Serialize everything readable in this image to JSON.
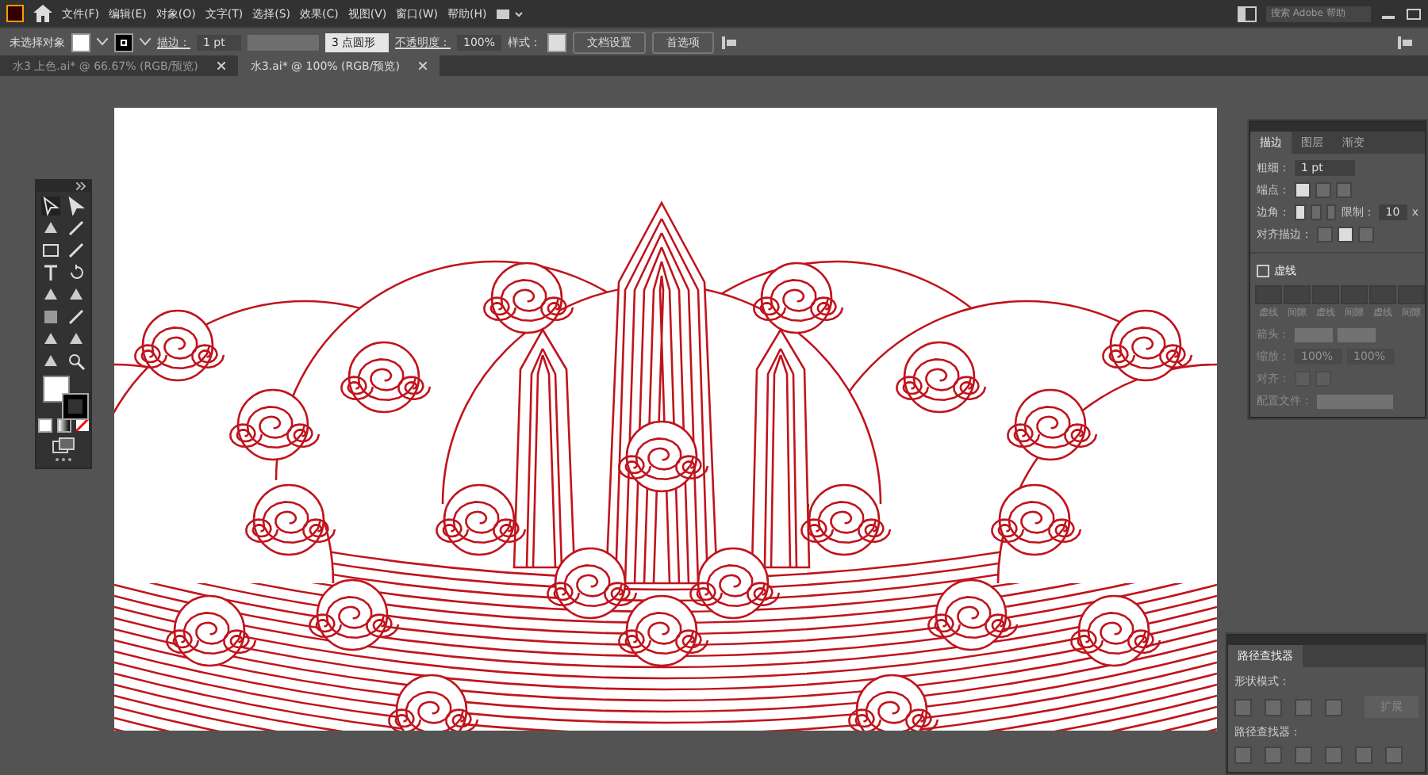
{
  "menu_bar": {
    "items": [
      "文件(F)",
      "编辑(E)",
      "对象(O)",
      "文字(T)",
      "选择(S)",
      "效果(C)",
      "视图(V)",
      "窗口(W)",
      "帮助(H)"
    ],
    "search": {
      "placeholder": "搜索 Adobe 帮助"
    }
  },
  "control_bar": {
    "selection": "未选择对象",
    "stroke_label": "描边：",
    "stroke_weight": "1 pt",
    "brush": "3 点圆形",
    "opacity_label": "不透明度：",
    "opacity": "100%",
    "style_label": "样式：",
    "buttons": [
      "文档设置",
      "首选项"
    ]
  },
  "tabs": [
    {
      "label": "水3 上色.ai* @ 66.67% (RGB/预览)",
      "selected": false
    },
    {
      "label": "水3.ai* @ 100% (RGB/预览)",
      "selected": true
    }
  ],
  "stroke_panel": {
    "tabs": [
      {
        "label": "描边",
        "selected": true
      },
      {
        "label": "图层",
        "selected": false
      },
      {
        "label": "渐变",
        "selected": false
      }
    ],
    "weight_label": "粗细：",
    "weight": "1 pt",
    "cap_label": "端点：",
    "corner_label": "边角：",
    "limit_label": "限制：",
    "limit": "10",
    "limit_unit": "x",
    "align_label": "对齐描边：",
    "dashed": {
      "label": "虚线",
      "checked": false,
      "disabled": true,
      "fields": [
        "虚线",
        "间隙",
        "虚线",
        "间隙",
        "虚线",
        "间隙"
      ]
    },
    "arrow_label": "箭头：",
    "scale_label": "缩放：",
    "scale": [
      "100%",
      "100%"
    ],
    "arrange_label": "对齐：",
    "profile_label": "配置文件："
  },
  "pathfinder_panel": {
    "title": "路径查找器",
    "shape_modes_label": "形状模式：",
    "expand": "扩展",
    "pathfinders_label": "路径查找器："
  }
}
